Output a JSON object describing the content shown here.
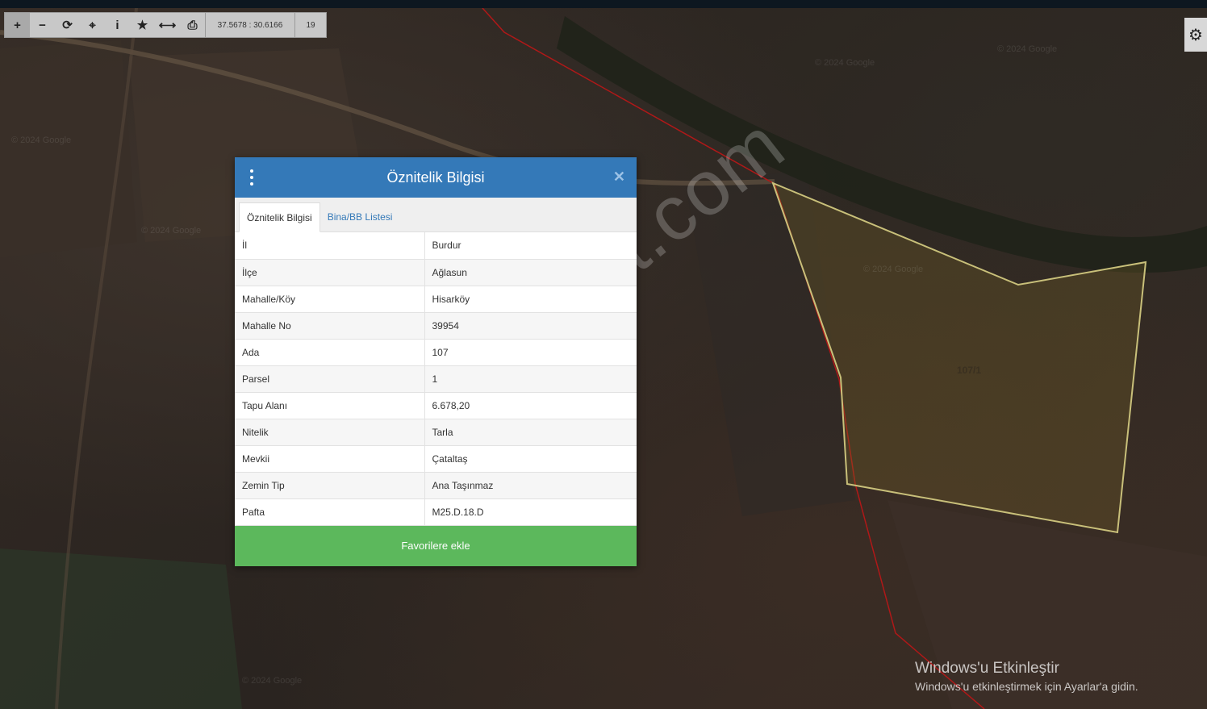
{
  "toolbar": {
    "coordinates": "37.5678 : 30.6166",
    "zoom_level": "19",
    "buttons": [
      {
        "icon": "plus-icon",
        "glyph": "+"
      },
      {
        "icon": "minus-icon",
        "glyph": "−"
      },
      {
        "icon": "refresh-icon",
        "glyph": "⟳"
      },
      {
        "icon": "locate-icon",
        "glyph": "⌖"
      },
      {
        "icon": "info-icon",
        "glyph": "i"
      },
      {
        "icon": "star-icon",
        "glyph": "★"
      },
      {
        "icon": "measure-icon",
        "glyph": "⟷"
      },
      {
        "icon": "print-icon",
        "glyph": "⎙"
      }
    ]
  },
  "settings_icon": "gear-icon",
  "map": {
    "watermark": "emlakjet.com",
    "parcel_label": "107/1",
    "google_marks": [
      "© 2024 Google",
      "© 2024 Google",
      "© 2024 Google",
      "© 2024 Google",
      "© 2024 Google",
      "© 2024 Google"
    ]
  },
  "popup": {
    "title": "Öznitelik Bilgisi",
    "tabs": [
      "Öznitelik Bilgisi",
      "Bina/BB Listesi"
    ],
    "rows": [
      {
        "key": "İl",
        "value": "Burdur"
      },
      {
        "key": "İlçe",
        "value": "Ağlasun"
      },
      {
        "key": "Mahalle/Köy",
        "value": "Hisarköy"
      },
      {
        "key": "Mahalle No",
        "value": "39954"
      },
      {
        "key": "Ada",
        "value": "107"
      },
      {
        "key": "Parsel",
        "value": "1"
      },
      {
        "key": "Tapu Alanı",
        "value": "6.678,20"
      },
      {
        "key": "Nitelik",
        "value": "Tarla"
      },
      {
        "key": "Mevkii",
        "value": "Çataltaş"
      },
      {
        "key": "Zemin Tip",
        "value": "Ana Taşınmaz"
      },
      {
        "key": "Pafta",
        "value": "M25.D.18.D"
      }
    ],
    "favorite_button": "Favorilere ekle"
  },
  "activation": {
    "title": "Windows'u Etkinleştir",
    "subtitle": "Windows'u etkinleştirmek için Ayarlar'a gidin."
  }
}
